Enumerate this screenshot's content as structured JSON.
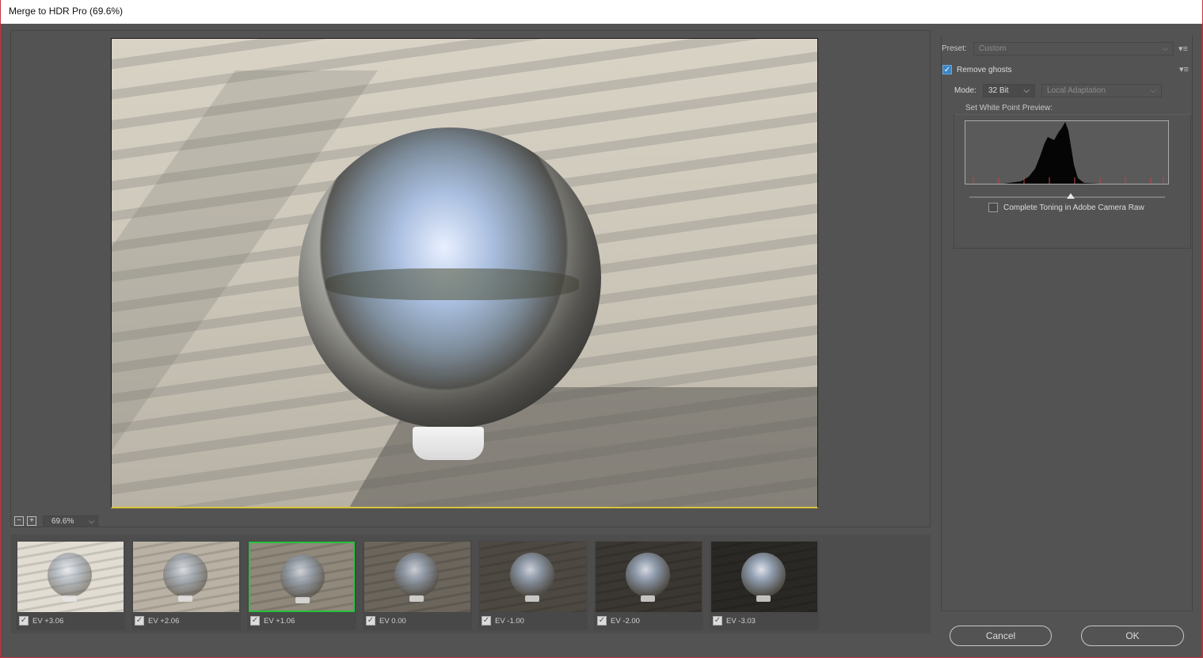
{
  "window": {
    "title": "Merge to HDR Pro (69.6%)"
  },
  "preview": {
    "zoom": "69.6%"
  },
  "zoom_controls": {
    "zoom_out": "−",
    "zoom_in": "+",
    "dropdown_icon": "chevron-down-icon"
  },
  "filmstrip": {
    "selected_index": 2,
    "items": [
      {
        "label": "EV +3.06",
        "checked": true,
        "tone": "#e2ddd3"
      },
      {
        "label": "EV +2.06",
        "checked": true,
        "tone": "#b9b2a4"
      },
      {
        "label": "EV +1.06",
        "checked": true,
        "tone": "#8f887b"
      },
      {
        "label": "EV 0.00",
        "checked": true,
        "tone": "#6b655b"
      },
      {
        "label": "EV -1.00",
        "checked": true,
        "tone": "#4d4942"
      },
      {
        "label": "EV -2.00",
        "checked": true,
        "tone": "#3a3732"
      },
      {
        "label": "EV -3.03",
        "checked": true,
        "tone": "#2a2824"
      }
    ]
  },
  "right_panel": {
    "preset_label": "Preset:",
    "preset_value": "Custom",
    "remove_ghosts_label": "Remove ghosts",
    "remove_ghosts_checked": true,
    "mode_label": "Mode:",
    "mode_value": "32 Bit",
    "method_value": "Local Adaptation",
    "white_point_label": "Set White Point Preview:",
    "white_point_value": 0.52,
    "complete_toning_label": "Complete Toning in Adobe Camera Raw",
    "complete_toning_checked": false
  },
  "buttons": {
    "cancel": "Cancel",
    "ok": "OK"
  }
}
